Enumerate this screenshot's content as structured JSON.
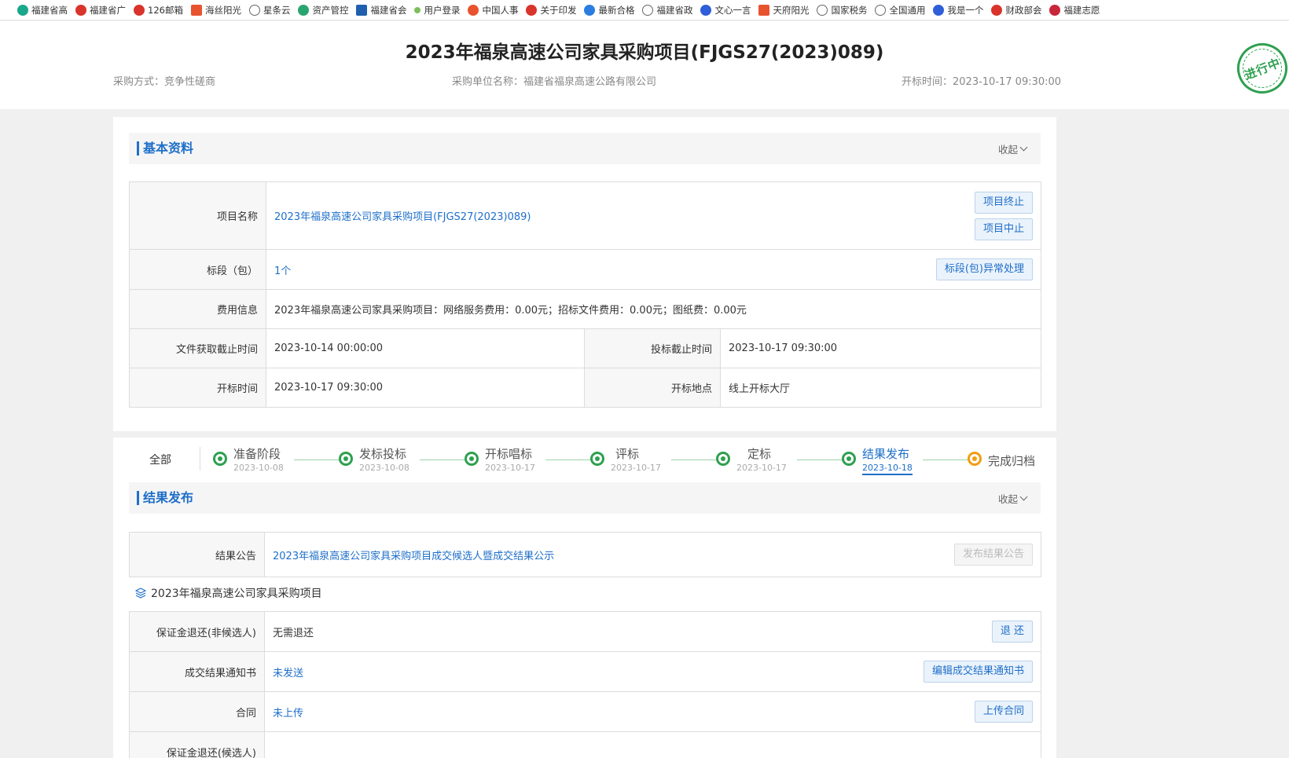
{
  "bookmarks": [
    "福建省高",
    "福建省广",
    "126邮箱",
    "海丝阳光",
    "星条云",
    "资产管控",
    "福建省会",
    "用户登录",
    "中国人事",
    "关于印发",
    "最新合格",
    "福建省政",
    "文心一言",
    "天府阳光",
    "国家税务",
    "全国通用",
    "我是一个",
    "财政部会",
    "福建志愿"
  ],
  "header": {
    "title": "2023年福泉高速公司家具采购项目(FJGS27(2023)089)",
    "method": "采购方式：竞争性磋商",
    "buyer": "采购单位名称：福建省福泉高速公路有限公司",
    "open_time": "开标时间：2023-10-17 09:30:00",
    "stamp": "进行中"
  },
  "basic": {
    "title": "基本资料",
    "collapse": "收起",
    "rows": {
      "name_label": "项目名称",
      "name_value": "2023年福泉高速公司家具采购项目(FJGS27(2023)089)",
      "terminate_btn": "项目终止",
      "suspend_btn": "项目中止",
      "lot_label": "标段（包）",
      "lot_value": "1个",
      "lot_btn": "标段(包)异常处理",
      "fee_label": "费用信息",
      "fee_value": "2023年福泉高速公司家具采购项目：网络服务费用：0.00元；招标文件费用：0.00元；图纸费：0.00元",
      "doc_deadline_label": "文件获取截止时间",
      "doc_deadline_value": "2023-10-14 00:00:00",
      "bid_deadline_label": "投标截止时间",
      "bid_deadline_value": "2023-10-17 09:30:00",
      "open_time_label": "开标时间",
      "open_time_value": "2023-10-17 09:30:00",
      "open_place_label": "开标地点",
      "open_place_value": "线上开标大厅"
    }
  },
  "steps": {
    "all": "全部",
    "items": [
      {
        "name": "准备阶段",
        "date": "2023-10-08"
      },
      {
        "name": "发标投标",
        "date": "2023-10-08"
      },
      {
        "name": "开标唱标",
        "date": "2023-10-17"
      },
      {
        "name": "评标",
        "date": "2023-10-17"
      },
      {
        "name": "定标",
        "date": "2023-10-17"
      },
      {
        "name": "结果发布",
        "date": "2023-10-18"
      },
      {
        "name": "完成归档",
        "date": ""
      }
    ]
  },
  "result": {
    "title": "结果发布",
    "collapse": "收起",
    "notice_label": "结果公告",
    "notice_value": "2023年福泉高速公司家具采购项目成交候选人暨成交结果公示",
    "notice_btn": "发布结果公告",
    "sub_title": "2023年福泉高速公司家具采购项目",
    "deposit_non_label": "保证金退还(非候选人)",
    "deposit_non_value": "无需退还",
    "deposit_non_btn": "退 还",
    "notice_letter_label": "成交结果通知书",
    "notice_letter_value": "未发送",
    "notice_letter_btn": "编辑成交结果通知书",
    "contract_label": "合同",
    "contract_value": "未上传",
    "contract_btn": "上传合同",
    "deposit_cand_label": "保证金退还(候选人)"
  },
  "colors": {
    "accent": "#1e6fc9",
    "green": "#2ea04f",
    "orange": "#f39c12"
  }
}
